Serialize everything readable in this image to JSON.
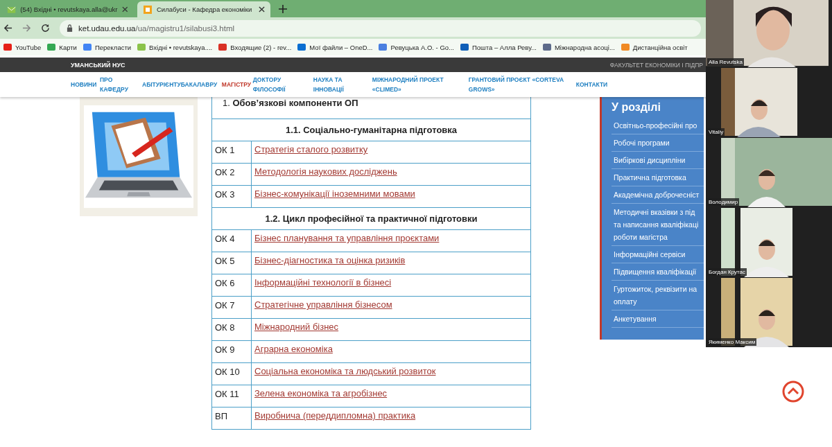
{
  "browser": {
    "tabs": [
      {
        "title": "(54) Вхідні • revutskaya.alla@ukr",
        "selected": false
      },
      {
        "title": "Силабуси - Кафедра економіки",
        "selected": true
      }
    ],
    "url": {
      "host": "ket.udau.edu.ua",
      "path": "/ua/magistru1/silabusi3.html"
    },
    "bookmarks": [
      {
        "label": "YouTube",
        "color": "#e62117"
      },
      {
        "label": "Карти",
        "color": "#34a853"
      },
      {
        "label": "Перекласти",
        "color": "#4285f4"
      },
      {
        "label": "Вхідні • revutskaya....",
        "color": "#8bc34a"
      },
      {
        "label": "Входящие (2) - rev...",
        "color": "#d93025"
      },
      {
        "label": "Мої файли – OneD...",
        "color": "#0a6ed1"
      },
      {
        "label": "Ревуцька А.О. - Go...",
        "color": "#4a7fe0"
      },
      {
        "label": "Пошта – Алла Реву...",
        "color": "#0f5fb8"
      },
      {
        "label": "Міжнародна асоці...",
        "color": "#5d6b8a"
      },
      {
        "label": "Дистанційна освіт",
        "color": "#f08a24"
      }
    ]
  },
  "site": {
    "name": "УМАНСЬКИЙ НУС",
    "faculty": "ФАКУЛЬТЕТ ЕКОНОМІКИ І ПІДПР",
    "nav": [
      {
        "label": "НОВИНИ",
        "selected": false
      },
      {
        "label": "ПРО\nКАФЕДРУ",
        "selected": false
      },
      {
        "label": "АБІТУРІЄНТУ",
        "selected": false
      },
      {
        "label": "БАКАЛАВРУ",
        "selected": false
      },
      {
        "label": "МАГІСТРУ",
        "selected": true
      },
      {
        "label": "ДОКТОРУ\nФІЛОСОФІЇ",
        "selected": false
      },
      {
        "label": "НАУКА ТА\nІННОВАЦІЇ",
        "selected": false
      },
      {
        "label": "МІЖНАРОДНИЙ ПРОЕКТ\n«CLIMED»",
        "selected": false
      },
      {
        "label": "ГРАНТОВИЙ ПРОЄКТ «CORTEVA\nGROWS»",
        "selected": false
      },
      {
        "label": "КОНТАКТИ",
        "selected": false
      }
    ]
  },
  "table": {
    "rows": [
      {
        "kind": "heading",
        "text": "1. **Обов’язкові компоненти ОП**"
      },
      {
        "kind": "section",
        "text": "1.1. Соціально-гуманітарна підготовка"
      },
      {
        "kind": "course",
        "code": "ОК 1",
        "title": "Стратегія сталого розвитку"
      },
      {
        "kind": "course",
        "code": "ОК 2",
        "title": "Методологія наукових досліджень"
      },
      {
        "kind": "course",
        "code": "ОК 3",
        "title": "Бізнес-комунікації іноземними мовами"
      },
      {
        "kind": "section",
        "text": "1.2. Цикл професійної та практичної підготовки"
      },
      {
        "kind": "course",
        "code": "ОК 4",
        "title": "Бізнес планування та управління проєктами"
      },
      {
        "kind": "course",
        "code": "ОК 5",
        "title": "Бізнес-діагностика та оцінка ризиків"
      },
      {
        "kind": "course",
        "code": "ОК  6",
        "title": "Інформаційні технології в бізнесі"
      },
      {
        "kind": "course",
        "code": "ОК 7",
        "title": "Стратегічне управління бізнесом"
      },
      {
        "kind": "course",
        "code": "ОК 8",
        "title": "Міжнародний бізнес"
      },
      {
        "kind": "course",
        "code": "ОК 9",
        "title": "Аграрна економіка"
      },
      {
        "kind": "course",
        "code": "ОК 10",
        "title": "Соціальна економіка та людський розвиток"
      },
      {
        "kind": "course",
        "code": "ОК 11",
        "title": "Зелена економіка та агробізнес"
      },
      {
        "kind": "course",
        "code": "ВП",
        "title": "Виробнича (переддипломна) практика"
      }
    ]
  },
  "sidebar": {
    "title": "У розділі",
    "items": [
      "Освітньо-професійні про",
      "Робочі програми",
      "Вибіркові дисципліни",
      "Практична підготовка",
      "Академічна доброчесніст",
      "Методичні вказівки з під\nта написання кваліфікаці\nроботи магістра",
      "Інформаційні сервіси",
      "Підвищення кваліфікації",
      "Гуртожиток, реквізити на\nоплату",
      "Анкетування"
    ]
  },
  "video": {
    "participants": [
      {
        "name": "Alla Revutska"
      },
      {
        "name": "Vitaliy"
      },
      {
        "name": "Володимир"
      },
      {
        "name": "Богдан Крутас"
      },
      {
        "name": "Якименко Максим"
      }
    ]
  }
}
